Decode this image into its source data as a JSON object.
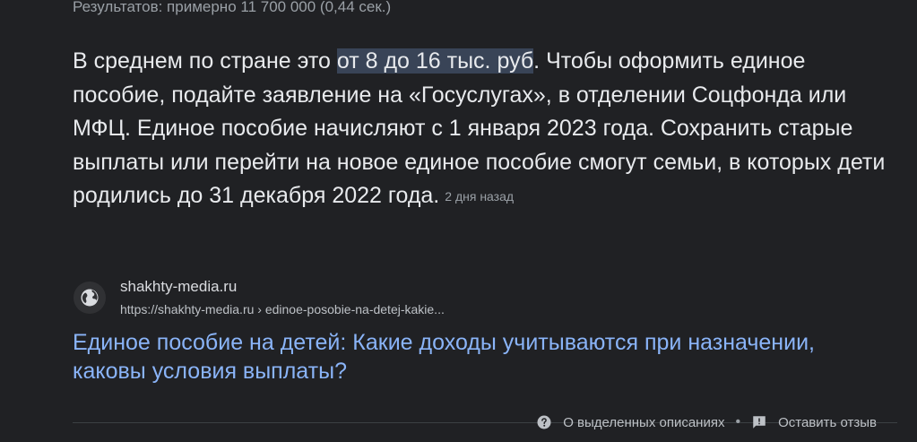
{
  "results_count": "Результатов: примерно 11 700 000 (0,44 сек.)",
  "snippet": {
    "before": "В среднем по стране это ",
    "highlight": "от 8 до 16 тыс. руб",
    "after": ". Чтобы оформить единое пособие, подайте заявление на «Госуслугах», в отделении Соцфонда или МФЦ. Единое пособие начисляют с 1 января 2023 года. Сохранить старые выплаты или перейти на новое единое пособие смогут семьи, в которых дети родились до 31 декабря 2022 года.",
    "date": "2 дня назад"
  },
  "source": {
    "icon": "globe-icon",
    "site_name": "shakhty-media.ru",
    "url": "https://shakhty-media.ru › edinoe-posobie-na-detej-kakie..."
  },
  "result_title": "Единое пособие на детей: Какие доходы учитываются при назначении, каковы условия выплаты?",
  "feedback": {
    "about_label": "О выделенных описаниях",
    "about_icon": "help-circle-icon",
    "separator": "•",
    "feedback_label": "Оставить отзыв",
    "feedback_icon": "feedback-icon"
  },
  "colors": {
    "background": "#202124",
    "text": "#e8eaed",
    "link": "#8ab4f8",
    "highlight": "#394457",
    "muted": "#9aa0a6"
  }
}
